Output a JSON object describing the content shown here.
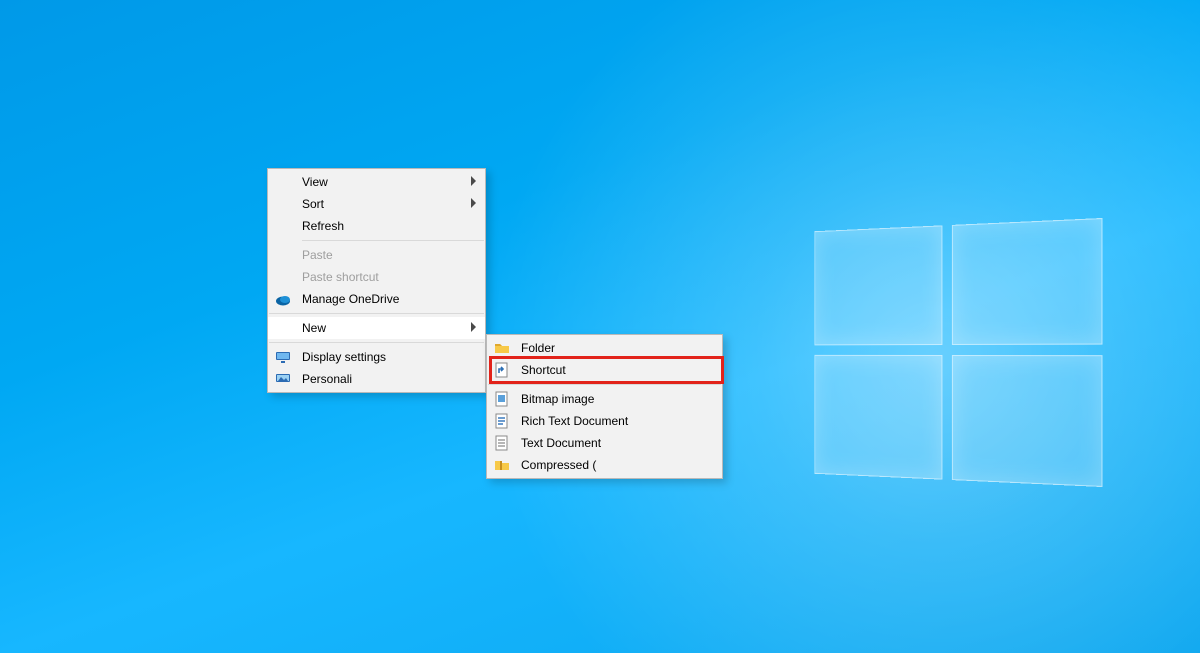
{
  "contextMenu": {
    "items": {
      "view": {
        "label": "View",
        "enabled": true,
        "hasSubmenu": true
      },
      "sort": {
        "label": "Sort",
        "enabled": true,
        "hasSubmenu": true
      },
      "refresh": {
        "label": "Refresh",
        "enabled": true
      },
      "paste": {
        "label": "Paste",
        "enabled": false
      },
      "pasteShortcut": {
        "label": "Paste shortcut",
        "enabled": false
      },
      "manageOneDrive": {
        "label": "Manage OneDrive",
        "enabled": true,
        "icon": "onedrive-icon"
      },
      "new": {
        "label": "New",
        "enabled": true,
        "hasSubmenu": true,
        "highlighted": true
      },
      "displaySettings": {
        "label": "Display settings",
        "enabled": true,
        "icon": "display-icon"
      },
      "personali": {
        "label": "Personali",
        "enabled": true,
        "icon": "personalize-icon"
      }
    }
  },
  "newSubmenu": {
    "items": {
      "folder": {
        "label": "Folder",
        "icon": "folder-icon"
      },
      "shortcut": {
        "label": "Shortcut",
        "icon": "shortcut-icon",
        "highlightedRed": true
      },
      "bitmap": {
        "label": "Bitmap image",
        "icon": "bitmap-icon"
      },
      "rtf": {
        "label": "Rich Text Document",
        "icon": "rtf-icon"
      },
      "txt": {
        "label": "Text Document",
        "icon": "txt-icon"
      },
      "zip": {
        "label": "Compressed (",
        "icon": "zip-icon"
      }
    }
  }
}
